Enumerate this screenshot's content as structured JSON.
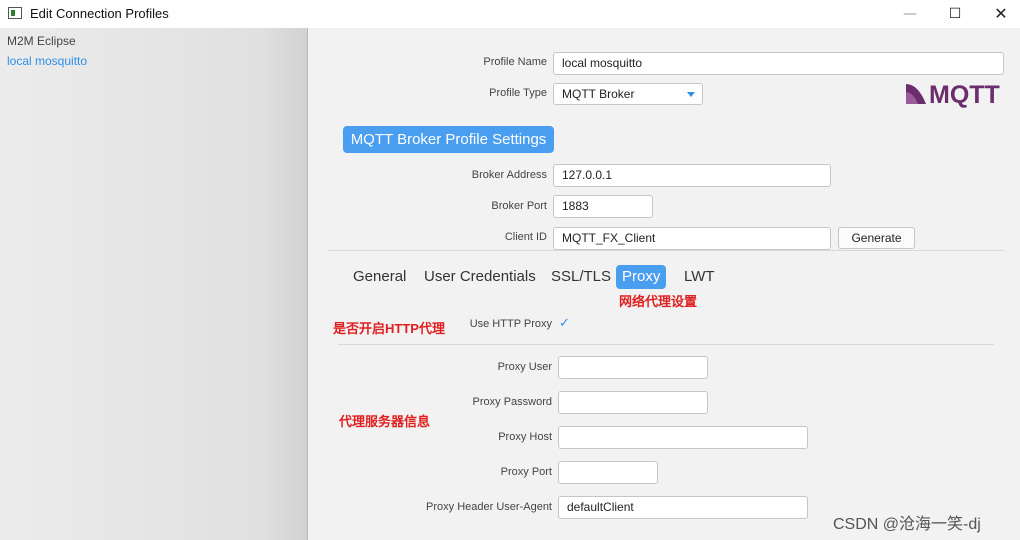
{
  "window": {
    "title": "Edit Connection Profiles",
    "minimize_icon": "minimize-icon",
    "maximize_icon": "maximize-icon",
    "close_icon": "close-icon"
  },
  "sidebar": {
    "items": [
      {
        "label": "M2M Eclipse",
        "selected": false
      },
      {
        "label": "local mosquitto",
        "selected": true
      }
    ]
  },
  "profile": {
    "name_label": "Profile Name",
    "name_value": "local mosquitto",
    "type_label": "Profile Type",
    "type_value": "MQTT Broker",
    "logo_text": "MQTT"
  },
  "broker": {
    "section_title": "MQTT Broker Profile Settings",
    "address_label": "Broker Address",
    "address_value": "127.0.0.1",
    "port_label": "Broker Port",
    "port_value": "1883",
    "client_id_label": "Client ID",
    "client_id_value": "MQTT_FX_Client",
    "generate_label": "Generate"
  },
  "tabs": [
    {
      "label": "General",
      "active": false
    },
    {
      "label": "User Credentials",
      "active": false
    },
    {
      "label": "SSL/TLS",
      "active": false
    },
    {
      "label": "Proxy",
      "active": true
    },
    {
      "label": "LWT",
      "active": false
    }
  ],
  "proxy": {
    "use_http_proxy_label": "Use HTTP Proxy",
    "use_http_proxy_checked": true,
    "user_label": "Proxy User",
    "user_value": "",
    "password_label": "Proxy Password",
    "password_value": "",
    "host_label": "Proxy Host",
    "host_value": "",
    "port_label": "Proxy Port",
    "port_value": "",
    "user_agent_label": "Proxy Header User-Agent",
    "user_agent_value": "defaultClient"
  },
  "annotations": {
    "proxy_settings": "网络代理设置",
    "enable_http_proxy": "是否开启HTTP代理",
    "proxy_server_info": "代理服务器信息"
  },
  "watermark": "CSDN @沧海一笑-dj",
  "colors": {
    "accent": "#4a9ef0",
    "link": "#2f8fe6",
    "annotation": "#e02020",
    "logo": "#6b2d6b"
  }
}
